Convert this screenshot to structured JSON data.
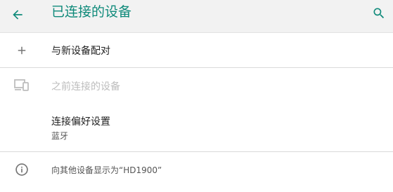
{
  "header": {
    "title": "已连接的设备",
    "back_icon": "arrow-back-icon",
    "search_icon": "search-icon",
    "accent_color": "#0f8a7a"
  },
  "items": [
    {
      "icon": "plus-icon",
      "label": "与新设备配对"
    },
    {
      "icon": "devices-icon",
      "label": "之前连接的设备",
      "disabled": true
    },
    {
      "label": "连接偏好设置",
      "sublabel": "蓝牙"
    }
  ],
  "footer": {
    "icon": "info-icon",
    "text": "向其他设备显示为“HD1900”"
  }
}
